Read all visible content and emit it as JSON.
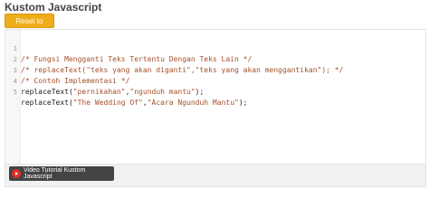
{
  "panel": {
    "title": "Kustom Javascript",
    "reset_label": "Reset to default"
  },
  "editor": {
    "lines": [
      {
        "num": "1",
        "text": "/* Fungsi Mengganti Teks Tertentu Dengan Teks Lain */"
      },
      {
        "num": "2",
        "text": "/* replaceText(\"teks yang akan diganti\",\"teks yang akan menggantikan\"); */"
      },
      {
        "num": "3",
        "text": "/* Contoh Implementasi */"
      },
      {
        "num": "4",
        "prefix": "replaceText(",
        "arg1": "\"pernikahan\"",
        "sep": ",",
        "arg2": "\"ngunduh mantu\"",
        "suffix": ");"
      },
      {
        "num": "5",
        "prefix": "replaceText(",
        "arg1": "\"The Wedding Of\"",
        "sep": ",",
        "arg2": "\"Acara Ngunduh Mantu\"",
        "suffix": ");"
      }
    ]
  },
  "footer": {
    "video_label": "Video Tutorial Kustom Javascript",
    "video_icon": "youtube-play-icon"
  },
  "colors": {
    "accent": "#f0ad1a",
    "comment": "#a5502a",
    "video_button": "#444444"
  }
}
